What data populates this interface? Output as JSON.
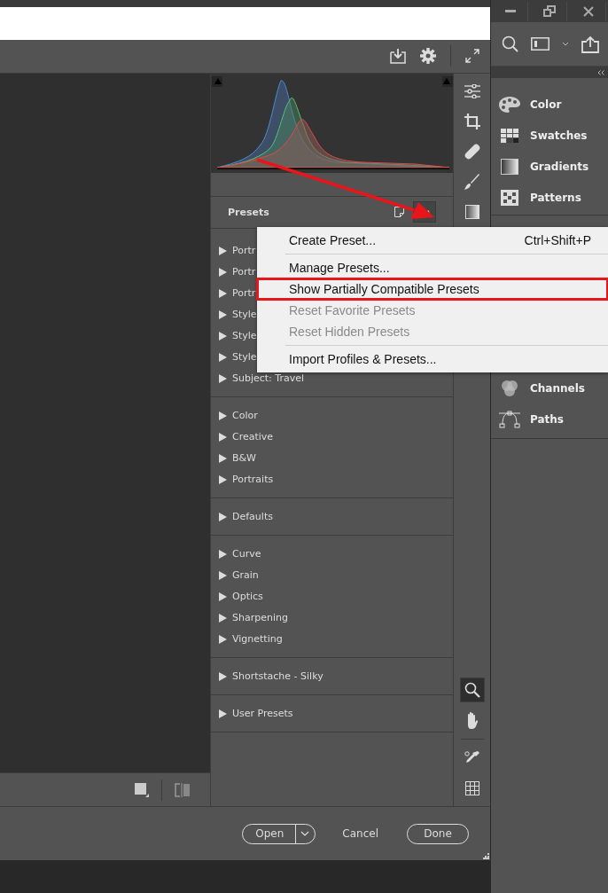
{
  "presets_panel": {
    "title": "Presets",
    "groups": [
      {
        "items": [
          {
            "label": "Portr",
            "expanded": false
          },
          {
            "label": "Portr",
            "expanded": false
          },
          {
            "label": "Portr",
            "expanded": false
          },
          {
            "label": "Style",
            "expanded": false
          },
          {
            "label": "Style",
            "expanded": false
          },
          {
            "label": "Style",
            "expanded": false
          },
          {
            "label": "Subject: Travel",
            "expanded": false
          }
        ]
      },
      {
        "items": [
          {
            "label": "Color",
            "expanded": false
          },
          {
            "label": "Creative",
            "expanded": false
          },
          {
            "label": "B&W",
            "expanded": false
          },
          {
            "label": "Portraits",
            "expanded": false
          }
        ]
      },
      {
        "items": [
          {
            "label": "Defaults",
            "expanded": false
          }
        ]
      },
      {
        "items": [
          {
            "label": "Curve",
            "expanded": false
          },
          {
            "label": "Grain",
            "expanded": false
          },
          {
            "label": "Optics",
            "expanded": false
          },
          {
            "label": "Sharpening",
            "expanded": false
          },
          {
            "label": "Vignetting",
            "expanded": false
          }
        ]
      },
      {
        "items": [
          {
            "label": "Shortstache - Silky",
            "expanded": false
          }
        ]
      },
      {
        "items": [
          {
            "label": "User Presets",
            "expanded": false
          }
        ]
      }
    ]
  },
  "presets_menu": {
    "sections": [
      {
        "items": [
          {
            "label": "Create Preset...",
            "shortcut": "Ctrl+Shift+P",
            "disabled": false,
            "highlighted": false
          }
        ]
      },
      {
        "items": [
          {
            "label": "Manage Presets...",
            "disabled": false,
            "highlighted": false
          },
          {
            "label": "Show Partially Compatible Presets",
            "disabled": false,
            "highlighted": true
          },
          {
            "label": "Reset Favorite Presets",
            "disabled": true,
            "highlighted": false
          },
          {
            "label": "Reset Hidden Presets",
            "disabled": true,
            "highlighted": false
          }
        ]
      },
      {
        "items": [
          {
            "label": "Import Profiles & Presets...",
            "disabled": false,
            "highlighted": false
          }
        ]
      }
    ]
  },
  "tools": {
    "top": [
      {
        "kind": "sliders",
        "selected": false
      },
      {
        "kind": "crop",
        "selected": false
      },
      {
        "kind": "healing",
        "selected": false
      },
      {
        "kind": "brush",
        "selected": false
      },
      {
        "kind": "gradient",
        "selected": false
      }
    ],
    "bottom": [
      {
        "kind": "zoom",
        "selected": true
      },
      {
        "kind": "hand",
        "selected": false
      },
      {
        "kind": "eyedropper",
        "selected": false
      },
      {
        "kind": "grid",
        "selected": false
      }
    ]
  },
  "footer": {
    "open_button": "Open",
    "cancel_button": "Cancel",
    "done_button": "Done"
  },
  "photoshop_panels": {
    "groups": [
      {
        "items": [
          {
            "label": "Color",
            "kind": "palette"
          },
          {
            "label": "Swatches",
            "kind": "swatches"
          },
          {
            "label": "Gradients",
            "kind": "gradient"
          },
          {
            "label": "Patterns",
            "kind": "pattern"
          }
        ]
      },
      {
        "items": [
          {
            "label": "Channels",
            "kind": "channels"
          },
          {
            "label": "Paths",
            "kind": "paths"
          }
        ]
      }
    ]
  }
}
